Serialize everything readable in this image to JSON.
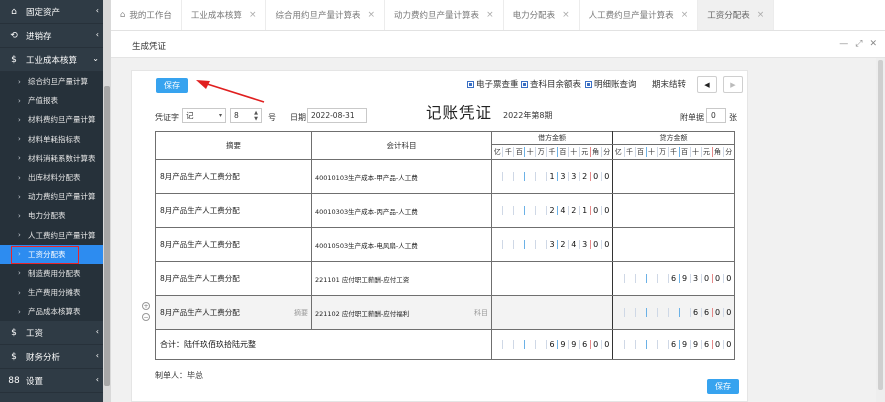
{
  "sidebar": {
    "top": [
      {
        "icon": "⌂",
        "label": "固定资产",
        "arrow": "‹"
      },
      {
        "icon": "⟲",
        "label": "进销存",
        "arrow": "‹"
      },
      {
        "icon": "$",
        "label": "工业成本核算",
        "arrow": "⌄"
      }
    ],
    "sub": [
      "综合约旦产量计算",
      "产值报表",
      "材料费约旦产量计算",
      "材料单耗指标表",
      "材料消耗系数计算表",
      "出库材料分配表",
      "动力费约旦产量计算",
      "电力分配表",
      "人工费约旦产量计算",
      "工资分配表",
      "制造费用分配表",
      "生产费用分摊表",
      "产品成本核算表"
    ],
    "active_index": 9,
    "bottom": [
      {
        "icon": "$",
        "label": "工资",
        "arrow": "‹"
      },
      {
        "icon": "$",
        "label": "财务分析",
        "arrow": "‹"
      },
      {
        "icon": "88",
        "label": "设置",
        "arrow": "‹"
      }
    ]
  },
  "tabs": [
    {
      "label": "我的工作台",
      "closable": false,
      "home": true
    },
    {
      "label": "工业成本核算",
      "closable": true
    },
    {
      "label": "综合用约旦产量计算表",
      "closable": true
    },
    {
      "label": "动力费约旦产量计算表",
      "closable": true
    },
    {
      "label": "电力分配表",
      "closable": true
    },
    {
      "label": "人工费约旦产量计算表",
      "closable": true
    },
    {
      "label": "工资分配表",
      "closable": true,
      "active": true
    }
  ],
  "panel": {
    "title": "生成凭证",
    "ctrl_min": "—",
    "ctrl_max": "⤢",
    "ctrl_close": "✕"
  },
  "toolbar": {
    "save": "保存",
    "e_invoice": "电子票查重",
    "balance": "查科目余额表",
    "detail": "明细账查询",
    "period_end": "期末结转",
    "prev": "◀",
    "next": "▶"
  },
  "voucher": {
    "word_label": "凭证字",
    "word_value": "记",
    "number_value": "8",
    "number_unit": "号",
    "date_label": "日期",
    "date_value": "2022-08-31",
    "title": "记账凭证",
    "period": "2022年第8期",
    "attach_label": "附单据",
    "attach_value": "0",
    "attach_unit": "张"
  },
  "table": {
    "col_summary": "摘要",
    "col_account": "会计科目",
    "col_debit": "借方金额",
    "col_credit": "贷方金额",
    "digit_units": [
      "亿",
      "千",
      "百",
      "十",
      "万",
      "千",
      "百",
      "十",
      "元",
      "角",
      "分"
    ],
    "rows": [
      {
        "summary": "8月产品生产人工费分配",
        "account": "40010103生产成本-甲产品-人工费",
        "debit": "133200",
        "credit": ""
      },
      {
        "summary": "8月产品生产人工费分配",
        "account": "40010303生产成本-丙产品-人工费",
        "debit": "242100",
        "credit": ""
      },
      {
        "summary": "8月产品生产人工费分配",
        "account": "40010503生产成本-电风扇-人工费",
        "debit": "324300",
        "credit": ""
      },
      {
        "summary": "8月产品生产人工费分配",
        "account": "221101 应付职工薪酬-应付工资",
        "debit": "",
        "credit": "693000"
      },
      {
        "summary": "8月产品生产人工费分配",
        "account": "221102 应付职工薪酬-应付福利",
        "debit": "",
        "credit": "6600",
        "summary_hint": "摘要",
        "account_hint": "科目"
      }
    ],
    "total_label": "合计：陆仟玖佰玖拾陆元整",
    "total_debit": "699600",
    "total_credit": "699600"
  },
  "footer": {
    "maker": "制单人：毕总",
    "save": "保存"
  }
}
